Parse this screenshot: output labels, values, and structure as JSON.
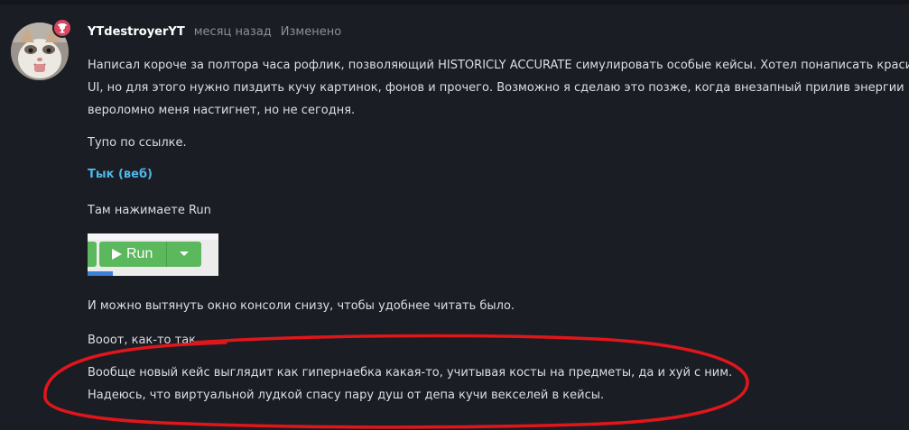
{
  "post": {
    "username": "YTdestroyerYT",
    "timestamp": "месяц назад",
    "edited_label": "Изменено",
    "paragraph_1_line_1": "Написал короче за полтора часа рофлик, позволяющий HISTORICLY ACCURATE симулировать особые кейсы. Хотел понаписать красивый",
    "paragraph_1_line_2": "UI, но для этого нужно пиздить кучу картинок, фонов и прочего. Возможно я сделаю это позже, когда внезапный прилив энергии",
    "paragraph_1_line_3": "вероломно меня настигнет, но не сегодня.",
    "paragraph_2": "Тупо по ссылке.",
    "link_text": "Тык (веб)",
    "paragraph_3": "Там нажимаете Run",
    "run_button_label": "Run",
    "paragraph_4": "И можно вытянуть окно консоли снизу, чтобы удобнее читать было.",
    "paragraph_5": "Вооот, как-то так.",
    "paragraph_6_line_1": "Вообще новый кейс выглядит как гипернаебка какая-то, учитывая косты на предметы, да и хуй с ним.",
    "paragraph_6_line_2": "Надеюсь, что виртуальной лудкой спасу пару душ от депа кучи векселей в кейсы."
  },
  "icons": {
    "badge": "trophy-icon",
    "run": "play-icon",
    "dropdown": "caret-down-icon"
  },
  "colors": {
    "background": "#1b1d24",
    "text": "#dcdee4",
    "link": "#4fb6ea",
    "muted": "#8b8e99",
    "badge": "#d9465e",
    "run_green": "#5cb85c",
    "annotation_red": "#e0161b"
  }
}
